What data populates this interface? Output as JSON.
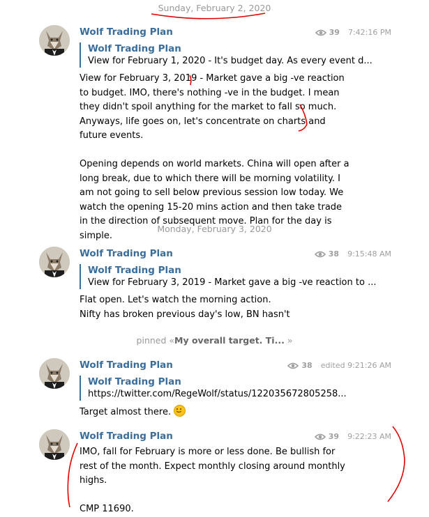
{
  "date_separators": {
    "first": "Sunday, February 2, 2020",
    "second": "Monday, February 3, 2020"
  },
  "messages": [
    {
      "author": "Wolf Trading Plan",
      "views": "39",
      "time": "7:42:16 PM",
      "reply_author": "Wolf Trading Plan",
      "reply_text": "View for February 1, 2020 - It's budget day. As every event d...",
      "paragraphs": [
        "View for February 3, 2019 - Market gave a big -ve reaction to budget. IMO, there's nothing -ve in the budget. I mean they didn't spoil anything for the market to fall so much. Anyways, life goes on, let's concentrate on charts and future events.",
        "Opening depends on world markets. China will open after a long break, due to which there will be morning volatility. I am not going to sell below previous session low today. We watch the opening 15-20 mins action and then take trade in the direction of subsequent move. Plan for the day is simple."
      ]
    },
    {
      "author": "Wolf Trading Plan",
      "views": "38",
      "time": "9:15:48 AM",
      "reply_author": "Wolf Trading Plan",
      "reply_text": "View for February 3, 2019 - Market gave a big -ve reaction to ...",
      "lines": [
        "Flat open. Let's watch the morning action.",
        "Nifty has broken previous day's low, BN hasn't"
      ]
    },
    {
      "pinned_prefix": "pinned «",
      "pinned_title": "My overall target. Ti...",
      "pinned_suffix": " »"
    },
    {
      "author": "Wolf Trading Plan",
      "views": "38",
      "time": "edited 9:21:26 AM",
      "reply_author": "Wolf Trading Plan",
      "reply_text": "https://twitter.com/RegeWolf/status/122035672805258...",
      "text": "Target almost there.",
      "emoji": "slightly-smiling-face"
    },
    {
      "author": "Wolf Trading Plan",
      "views": "39",
      "time": "9:22:23 AM",
      "lines": [
        "IMO, fall for February is more or less done. Be bullish for rest of the month. Expect monthly closing around monthly highs.",
        "CMP 11690."
      ]
    }
  ],
  "colors": {
    "author": "#3a6d99",
    "meta": "#a0a0a0",
    "annotation": "#e00000"
  },
  "icons": [
    "eye-icon",
    "wolf-avatar",
    "smile-emoji"
  ]
}
